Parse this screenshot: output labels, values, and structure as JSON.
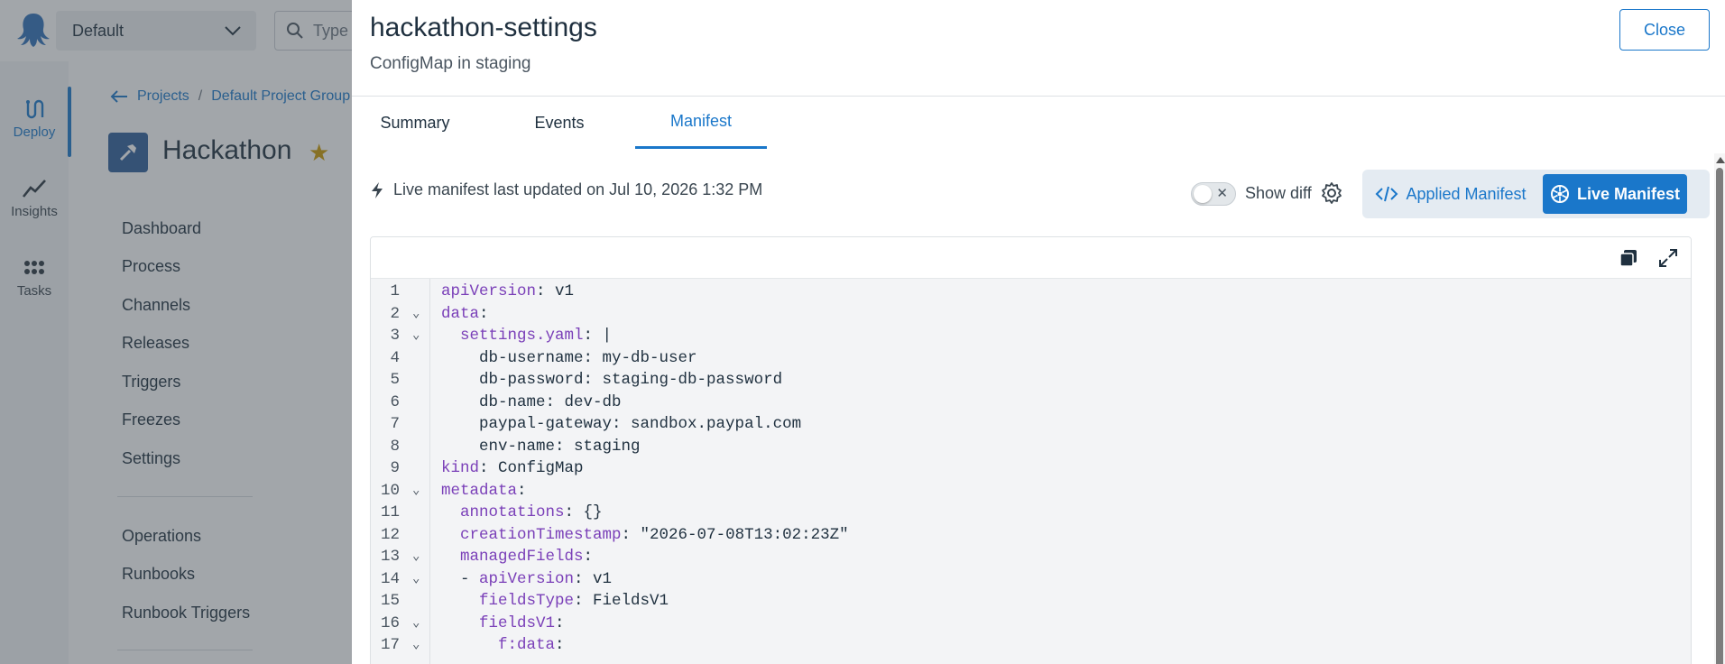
{
  "app": {
    "space_name": "Default",
    "search_placeholder": "Type"
  },
  "left_nav": [
    {
      "label": "Deploy",
      "icon": "deploy-icon",
      "active": true
    },
    {
      "label": "Insights",
      "icon": "insights-icon"
    },
    {
      "label": "Tasks",
      "icon": "tasks-icon"
    }
  ],
  "breadcrumb": {
    "items": [
      "Projects",
      "Default Project Group"
    ],
    "separator": "/"
  },
  "project": {
    "title": "Hackathon",
    "nav_items": [
      "Dashboard",
      "Process",
      "Channels",
      "Releases",
      "Triggers",
      "Freezes",
      "Settings"
    ],
    "ops_items": [
      "Operations",
      "Runbooks",
      "Runbook Triggers"
    ]
  },
  "drawer": {
    "title": "hackathon-settings",
    "subtitle": "ConfigMap in staging",
    "close_label": "Close",
    "tabs": [
      {
        "label": "Summary"
      },
      {
        "label": "Events"
      },
      {
        "label": "Manifest",
        "active": true
      }
    ],
    "status_text": "Live manifest last updated on Jul 10, 2026 1:32 PM",
    "show_diff_label": "Show diff",
    "applied_label": "Applied Manifest",
    "live_label": "Live Manifest"
  },
  "manifest": {
    "lines": [
      {
        "n": "1",
        "key": "apiVersion",
        "rest": ": v1"
      },
      {
        "n": "2",
        "key": "data",
        "rest": ":",
        "fold": true
      },
      {
        "n": "3",
        "indent": "  ",
        "key": "settings.yaml",
        "rest": ": |",
        "fold": true
      },
      {
        "n": "4",
        "indent": "    ",
        "plain": "db-username: my-db-user"
      },
      {
        "n": "5",
        "indent": "    ",
        "plain": "db-password: staging-db-password"
      },
      {
        "n": "6",
        "indent": "    ",
        "plain": "db-name: dev-db"
      },
      {
        "n": "7",
        "indent": "    ",
        "plain": "paypal-gateway: sandbox.paypal.com"
      },
      {
        "n": "8",
        "indent": "    ",
        "plain": "env-name: staging"
      },
      {
        "n": "9",
        "key": "kind",
        "rest": ": ConfigMap"
      },
      {
        "n": "10",
        "key": "metadata",
        "rest": ":",
        "fold": true
      },
      {
        "n": "11",
        "indent": "  ",
        "key": "annotations",
        "rest": ": {}"
      },
      {
        "n": "12",
        "indent": "  ",
        "key": "creationTimestamp",
        "rest": ": \"2026-07-08T13:02:23Z\""
      },
      {
        "n": "13",
        "indent": "  ",
        "key": "managedFields",
        "rest": ":",
        "fold": true
      },
      {
        "n": "14",
        "indent": "  - ",
        "key": "apiVersion",
        "rest": ": v1",
        "fold": true
      },
      {
        "n": "15",
        "indent": "    ",
        "key": "fieldsType",
        "rest": ": FieldsV1"
      },
      {
        "n": "16",
        "indent": "    ",
        "key": "fieldsV1",
        "rest": ":",
        "fold": true
      },
      {
        "n": "17",
        "indent": "      ",
        "key": "f:data",
        "rest": ":",
        "fold": true
      }
    ]
  },
  "colors": {
    "accent": "#1a77ca",
    "yaml_key": "#7a3fb8",
    "star": "#cc9a00"
  }
}
